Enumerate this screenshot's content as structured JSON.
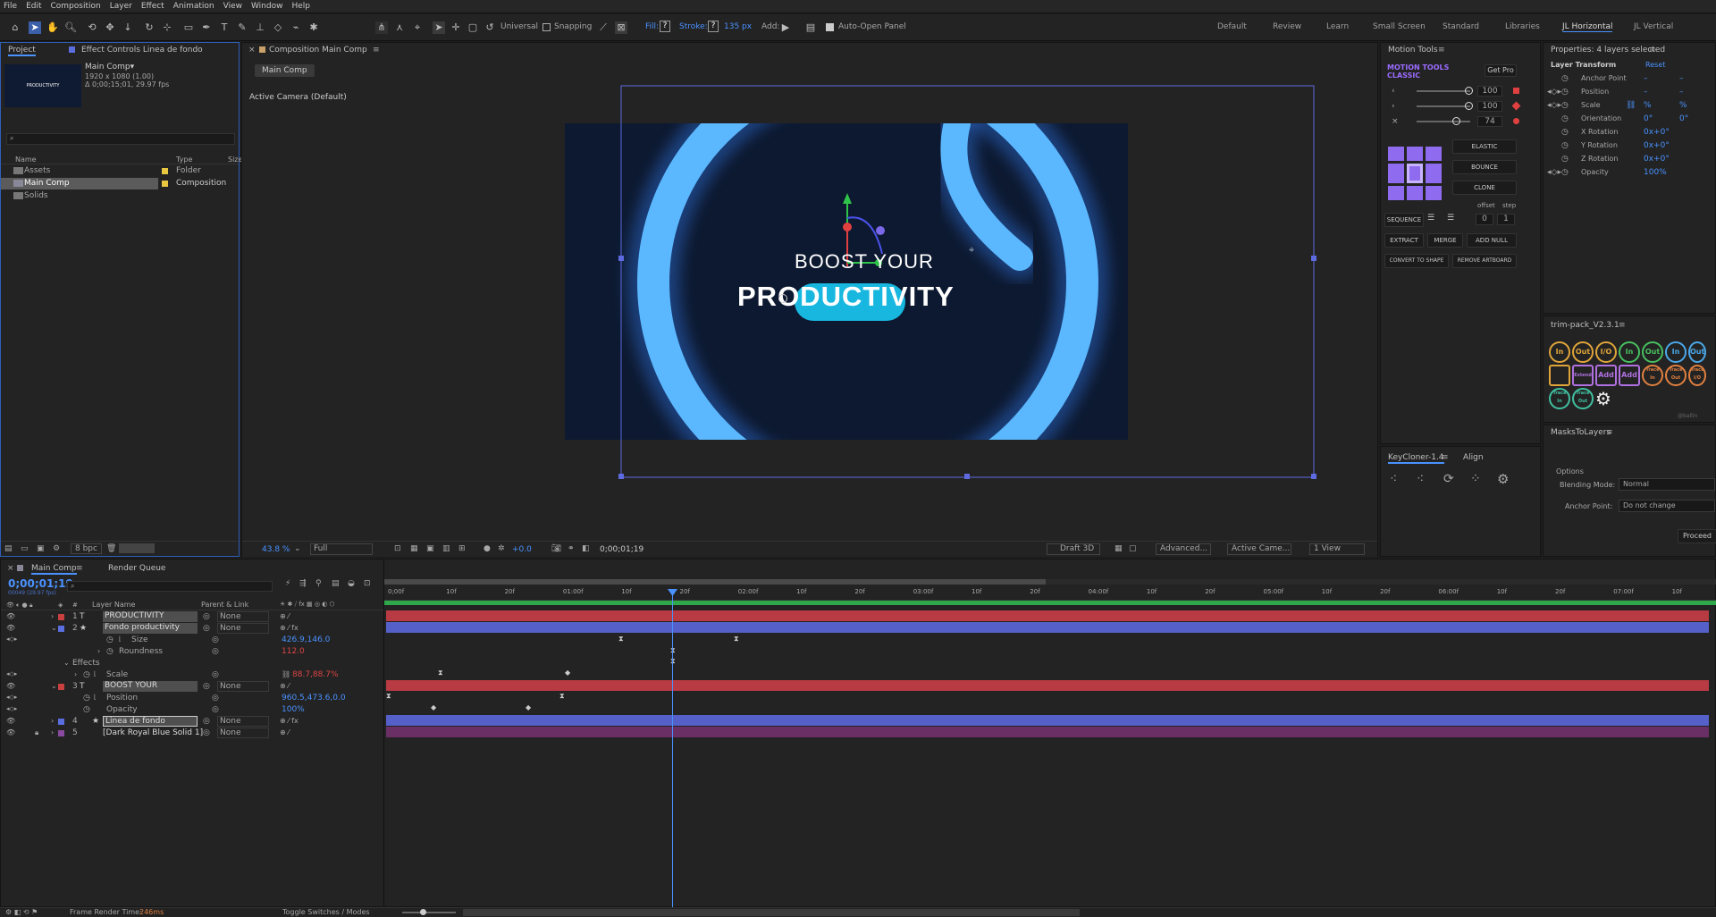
{
  "menu": [
    "File",
    "Edit",
    "Composition",
    "Layer",
    "Effect",
    "Animation",
    "View",
    "Window",
    "Help"
  ],
  "toolbar": {
    "universal": "Universal",
    "snapping": "Snapping",
    "fill_label": "Fill:",
    "fill_value": "?",
    "stroke_label": "Stroke:",
    "stroke_value": "?",
    "stroke_px": "135 px",
    "add_label": "Add:",
    "auto_open": "Auto-Open Panel"
  },
  "workspaces": [
    "Default",
    "Review",
    "Learn",
    "Small Screen",
    "Standard",
    "Libraries",
    "JL Horizontal",
    "JL Vertical"
  ],
  "project": {
    "tab": "Project",
    "effect_tab": "Effect Controls Linea de fondo",
    "comp_name": "Main Comp▾",
    "comp_res": "1920 x 1080 (1.00)",
    "comp_dur": "Δ 0;00;15;01, 29.97 fps",
    "thumb_text": "PRODUCTIVITY",
    "search_placeholder": "",
    "col_name": "Name",
    "col_type": "Type",
    "col_size": "Size",
    "items": [
      {
        "name": "Assets",
        "type": "Folder"
      },
      {
        "name": "Main Comp",
        "type": "Composition"
      },
      {
        "name": "Solids",
        "type": "Folder"
      }
    ],
    "bpc": "8 bpc"
  },
  "comp": {
    "tab": "Composition Main Comp",
    "subtab": "Main Comp",
    "camera": "Active Camera (Default)",
    "line1": "BOOST YOUR",
    "line2": "PRODUCTIVITY",
    "zoom": "43.8 %",
    "res": "Full",
    "exposure": "+0.0",
    "time": "0;00;01;19",
    "draft": "Draft 3D",
    "renderer": "Advanced...",
    "camera_sel": "Active Came...",
    "view": "1 View"
  },
  "motion_tools": {
    "title": "Motion Tools",
    "brand1": "MOTION TOOLS",
    "brand2": "CLASSIC",
    "get_pro": "Get Pro",
    "v1": "100",
    "v2": "100",
    "v3": "74",
    "elastic": "ELASTIC",
    "bounce": "BOUNCE",
    "clone": "CLONE",
    "offset": "offset",
    "step": "step",
    "offset_v": "0",
    "step_v": "1",
    "sequence": "SEQUENCE",
    "extract": "EXTRACT",
    "merge": "MERGE",
    "add_null": "ADD NULL",
    "convert": "CONVERT TO SHAPE",
    "remove": "REMOVE ARTBOARD"
  },
  "properties": {
    "title": "Properties: 4 layers selected",
    "section": "Layer Transform",
    "reset": "Reset",
    "rows": [
      {
        "label": "Anchor Point",
        "v1": "–",
        "v2": "–"
      },
      {
        "label": "Position",
        "v1": "–",
        "v2": "–"
      },
      {
        "label": "Scale",
        "v1": "%",
        "v2": "%"
      },
      {
        "label": "Orientation",
        "v1": "0°",
        "v2": "0°"
      },
      {
        "label": "X Rotation",
        "v1": "0x+0°",
        "v2": ""
      },
      {
        "label": "Y Rotation",
        "v1": "0x+0°",
        "v2": ""
      },
      {
        "label": "Z Rotation",
        "v1": "0x+0°",
        "v2": ""
      },
      {
        "label": "Opacity",
        "v1": "100%",
        "v2": ""
      }
    ]
  },
  "trim": {
    "title": "trim-pack_V2.3.1",
    "icons": [
      "In",
      "Out",
      "I/O",
      "In",
      "Out",
      "In",
      "Out",
      "",
      "Extend",
      "Add",
      "Add",
      "Trace In",
      "Trace Out",
      "Trace I/O",
      "Trace In",
      "Trace Out",
      ""
    ],
    "footer": "@ballin"
  },
  "keycloner": {
    "title": "KeyCloner-1.4",
    "align": "Align"
  },
  "masks": {
    "title": "MasksToLayers",
    "options": "Options",
    "blend_label": "Blending Mode:",
    "blend_value": "Normal",
    "anchor_label": "Anchor Point:",
    "anchor_value": "Do not change",
    "proceed": "Proceed"
  },
  "timeline": {
    "tab": "Main Comp",
    "render_queue": "Render Queue",
    "time": "0;00;01;19",
    "frames": "00049 (29.97 fps)",
    "col_layer": "Layer Name",
    "col_parent": "Parent & Link",
    "ruler": [
      "0;00f",
      "10f",
      "20f",
      "01:00f",
      "10f",
      "20f",
      "02:00f",
      "10f",
      "20f",
      "03:00f",
      "10f",
      "20f",
      "04:00f",
      "10f",
      "20f",
      "05:00f",
      "10f",
      "20f",
      "06:00f",
      "10f",
      "20f",
      "07:00f",
      "10f"
    ],
    "layers": [
      {
        "num": "1",
        "name": "PRODUCTIVITY",
        "parent": "None",
        "kind": "T"
      },
      {
        "num": "2",
        "name": "Fondo productivity",
        "parent": "None",
        "kind": "★"
      },
      {
        "prop": "Size",
        "value": "426.9,146.0"
      },
      {
        "prop": "Roundness",
        "value": "112.0"
      },
      {
        "prop": "Effects",
        "value": ""
      },
      {
        "prop": "Scale",
        "value": "88.7,88.7%"
      },
      {
        "num": "3",
        "name": "BOOST YOUR",
        "parent": "None",
        "kind": "T"
      },
      {
        "prop": "Position",
        "value": "960.5,473.6,0.0"
      },
      {
        "prop": "Opacity",
        "value": "100%"
      },
      {
        "num": "4",
        "name": "Linea de fondo",
        "parent": "None",
        "kind": "★"
      },
      {
        "num": "5",
        "name": "[Dark Royal Blue Solid 1]",
        "parent": "None",
        "kind": ""
      }
    ],
    "render_time_label": "Frame Render Time:",
    "render_time": "246ms",
    "toggle": "Toggle Switches / Modes"
  },
  "colors": {
    "accent": "#4a92ff",
    "red_track": "#b83a43",
    "blue_track": "#5560c8",
    "comp_bg": "#0d1930",
    "ring": "#5bb8ff"
  }
}
